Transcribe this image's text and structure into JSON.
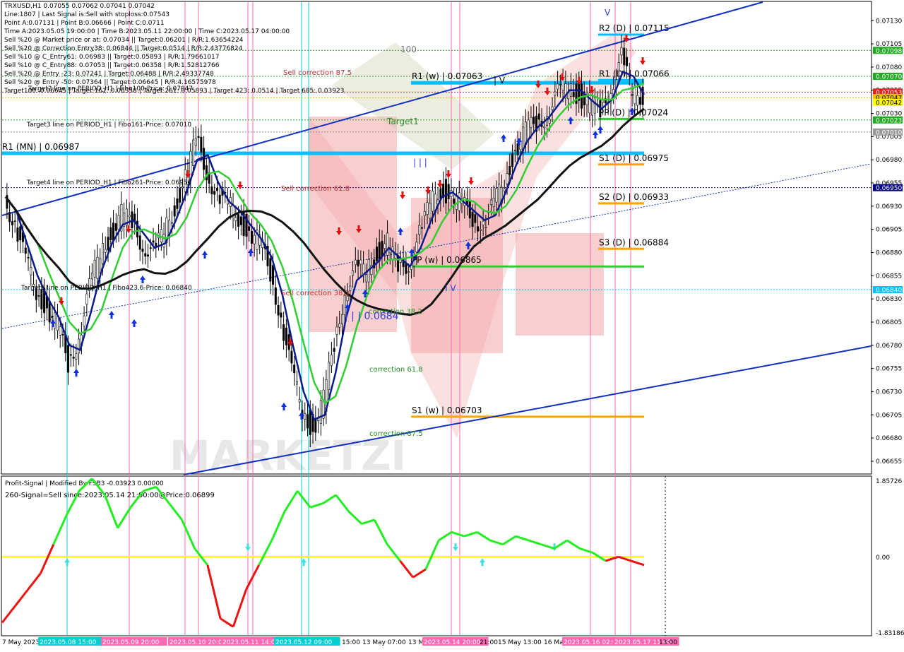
{
  "header": {
    "symbol_line": "TRXUSD,H1  0.07055 0.07062 0.07041 0.07042",
    "lines": [
      "Line:1807 | Last Signal is:Sell with stoploss:0.07543",
      "Point A:0.07131 | Point B:0.06666 | Point C:0.0711",
      "Time A:2023.05.05 19:00:00 | Time B:2023.05.11 22:00:00 | Time C:2023.05.17 04:00:00",
      "Sell %20 @ Market price or at: 0.07034 || Target:0.06201 | R/R:1.63654224",
      "Sell %20 @ Correction Entry38: 0.06844 || Target:0.0514 | R/R:2.43776824",
      "Sell %10 @ C_Entry61: 0.06983 || Target:0.05893 | R/R:1.79661017",
      "Sell %10 @ C_Entry88: 0.07053 || Target:0.06358 | R/R:1.52812766",
      "Sell %20 @ Entry -23: 0.07241 | Target:0.06488 | R/R:2.49337748",
      "Sell %20 @ Entry -50: 0.07364 || Target:0.06645 | R/R:4.16575978",
      "Target100: 0.06645 | Target 161: 0.06358 | Target 261: 0.05893 | Target 423: 0.0514 | Target 685: 0.03923"
    ]
  },
  "chart_data": [
    {
      "type": "line",
      "title": "TRXUSD,H1",
      "ylim": [
        0.06642,
        0.0715
      ],
      "y_ticks": [
        "0.07130",
        "0.07105",
        "0.07080",
        "0.07055",
        "0.07030",
        "0.07005",
        "0.06980",
        "0.06955",
        "0.06930",
        "0.06905",
        "0.06880",
        "0.06855",
        "0.06830",
        "0.06805",
        "0.06780",
        "0.06755",
        "0.06730",
        "0.06705",
        "0.06680",
        "0.06655"
      ],
      "x_tick_labels": [
        "7 May 2023",
        "2023.05.08 15:00",
        "2023.05.09 20:00",
        "2023.05.10 20:00",
        "2023.05.11 14:00",
        "2023.05.12 09:00",
        "15:00",
        "13 May 07:00",
        "13 May",
        "2023.05.14 20:00",
        "21:00",
        "15 May 13:00",
        "16 May",
        "2023.05.16 02:00",
        "2023.05.17 11:00",
        "13:00"
      ],
      "price_badges": [
        {
          "value": "0.07098",
          "color": "#22aa22"
        },
        {
          "value": "0.07070",
          "color": "#22aa22"
        },
        {
          "value": "0.07053",
          "color": "#e02020"
        },
        {
          "value": "0.07047",
          "color": "#e8c000"
        },
        {
          "value": "0.07042",
          "color": "#ffff00"
        },
        {
          "value": "0.07023",
          "color": "#22aa22"
        },
        {
          "value": "0.07010",
          "color": "#999999"
        },
        {
          "value": "0.06950",
          "color": "#000080"
        },
        {
          "value": "0.06840",
          "color": "#00bfff"
        }
      ],
      "levels": [
        {
          "label": "R2 (D) | 0.07115",
          "value": 0.07115,
          "color": "#00bfff"
        },
        {
          "label": "R1 (D) | 0.07066",
          "value": 0.07066,
          "color": "#00bfff"
        },
        {
          "label": "R1 (w) | 0.07063",
          "value": 0.07063,
          "color": "#00bfff"
        },
        {
          "label": "PP (D) | 0.07024",
          "value": 0.07024,
          "color": "#32cd32"
        },
        {
          "label": "R1 (MN) | 0.06987",
          "value": 0.06987,
          "color": "#00bfff"
        },
        {
          "label": "S1 (D) | 0.06975",
          "value": 0.06975,
          "color": "#ffa500"
        },
        {
          "label": "S2 (D) | 0.06933",
          "value": 0.06933,
          "color": "#ffa500"
        },
        {
          "label": "S3 (D) | 0.06884",
          "value": 0.06884,
          "color": "#ffa500"
        },
        {
          "label": "PP (w) | 0.06865",
          "value": 0.06865,
          "color": "#32cd32"
        },
        {
          "label": "S1 (w) | 0.06703",
          "value": 0.06703,
          "color": "#ffa500"
        }
      ],
      "annotations": [
        "100",
        "Sell correction 87.5",
        "Target1",
        "Sell correction 61.8",
        "Sell correction 38.2",
        "correction 38.2",
        "correction 61.8",
        "correction 87.5",
        "| | | 0.0684",
        "| | |",
        "| V",
        "I V",
        "V",
        "Target3 line on PERIOD_H1 | Fibo161-Price: 0.07010",
        "Target4 line on PERIOD_H1 | Fibo261-Price: 0.06950",
        "Target5 line on PERIOD_H1 | Fibo423.6-Price: 0.06840",
        "Target2 line on PERIOD_H1 | Fibo100-Price: 0.07047"
      ],
      "close_series": [
        0.0694,
        0.0691,
        0.0687,
        0.0684,
        0.0682,
        0.068,
        0.0676,
        0.0679,
        0.0684,
        0.0688,
        0.069,
        0.0692,
        0.0691,
        0.0689,
        0.0688,
        0.069,
        0.0693,
        0.0696,
        0.07,
        0.0697,
        0.0694,
        0.0693,
        0.0692,
        0.069,
        0.0689,
        0.0686,
        0.0681,
        0.0675,
        0.0671,
        0.0669,
        0.0672,
        0.0678,
        0.0684,
        0.0686,
        0.0686,
        0.0688,
        0.0689,
        0.0686,
        0.0687,
        0.069,
        0.0693,
        0.0695,
        0.0694,
        0.0693,
        0.0692,
        0.0691,
        0.0693,
        0.0696,
        0.0699,
        0.0701,
        0.0702,
        0.0703,
        0.0705,
        0.0706,
        0.0705,
        0.0704,
        0.0703,
        0.0706,
        0.0709,
        0.0705,
        0.0705
      ]
    },
    {
      "type": "line",
      "title": "Profit-Signal | Modified By FSB3 -0.03923 0.00000",
      "subtitle": "260-Signal=Sell since:2023.05.14 21:00:00@Price:0.06899",
      "y_ticks": [
        "1.85726",
        "0.00",
        "-1.83186"
      ],
      "ylim": [
        -1.83186,
        1.85726
      ],
      "series_values": [
        -1.6,
        -1.2,
        -0.8,
        -0.4,
        0.3,
        1.0,
        1.6,
        1.9,
        1.5,
        0.7,
        1.2,
        1.6,
        1.7,
        1.3,
        0.9,
        0.2,
        -0.2,
        -1.5,
        -1.7,
        -0.8,
        -0.2,
        0.4,
        1.1,
        1.6,
        1.2,
        1.3,
        1.5,
        1.1,
        0.8,
        0.9,
        0.3,
        -0.1,
        -0.5,
        -0.3,
        0.4,
        0.6,
        0.5,
        0.6,
        0.4,
        0.3,
        0.5,
        0.4,
        0.3,
        0.2,
        0.4,
        0.2,
        0.1,
        -0.1,
        0.0,
        -0.1,
        -0.2
      ]
    }
  ]
}
